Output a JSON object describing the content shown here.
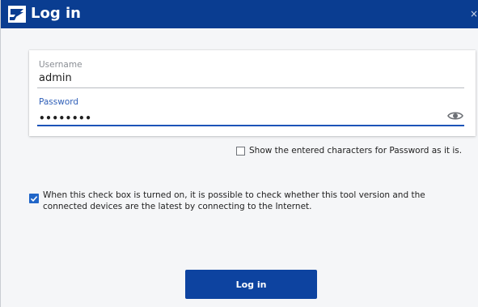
{
  "window": {
    "title": "Log in",
    "close_glyph": "×"
  },
  "form": {
    "username_label": "Username",
    "username_value": "admin",
    "password_label": "Password",
    "password_value": "••••••••"
  },
  "options": {
    "show_password_label": "Show the entered characters for Password as it is.",
    "show_password_checked": false,
    "update_check_label": "When this check box is turned on, it is possible to check whether this tool version and the connected devices are the latest by connecting to the Internet.",
    "update_check_checked": true
  },
  "actions": {
    "login_label": "Log in"
  },
  "colors": {
    "titlebar": "#0a3d91",
    "accent": "#1c54b8",
    "button": "#0d43a0",
    "checkbox": "#2166c8"
  },
  "icons": {
    "app": "app-logo-icon",
    "reveal": "eye-icon",
    "close": "close-icon",
    "check": "checkmark-icon"
  }
}
